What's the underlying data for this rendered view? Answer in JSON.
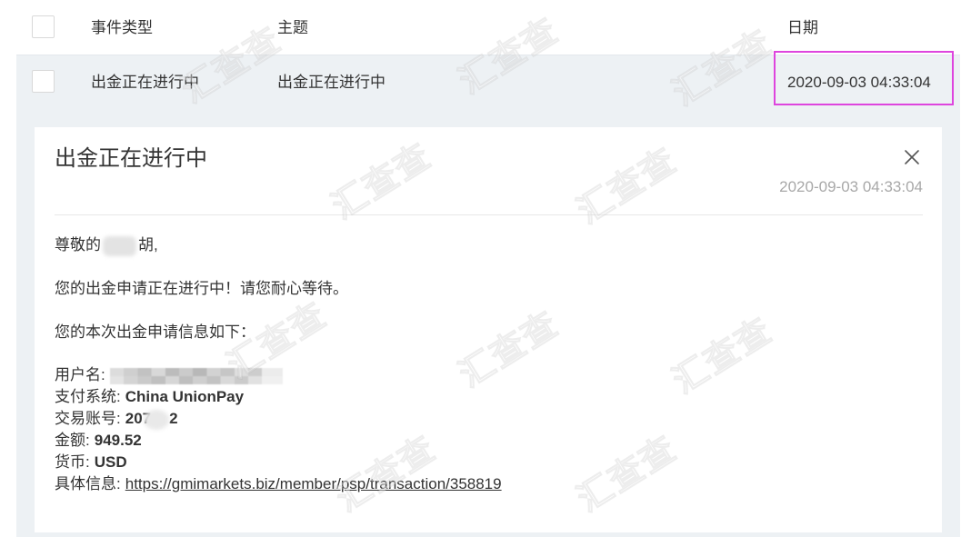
{
  "list": {
    "header": {
      "event_type": "事件类型",
      "subject": "主题",
      "date": "日期"
    },
    "rows": [
      {
        "event_type": "出金正在进行中",
        "subject": "出金正在进行中",
        "date": "2020-09-03 04:33:04"
      }
    ]
  },
  "message": {
    "title": "出金正在进行中",
    "date": "2020-09-03 04:33:04",
    "greeting_prefix": "尊敬的",
    "greeting_suffix": "胡,",
    "line_progress": "您的出金申请正在进行中！请您耐心等待。",
    "line_intro": "您的本次出金申请信息如下：",
    "details": {
      "username_label": "用户名:",
      "payment_system_label": "支付系统:",
      "payment_system": "China UnionPay",
      "account_label": "交易账号:",
      "account_prefix": "207",
      "account_suffix": "2",
      "amount_label": "金额:",
      "amount": "949.52",
      "currency_label": "货币:",
      "currency": "USD",
      "info_label": "具体信息:",
      "info_link": "https://gmimarkets.biz/member/psp/transaction/358819"
    }
  },
  "watermark": {
    "text": "汇查查"
  },
  "colors": {
    "panel_background": "#edf1f4",
    "highlight_border": "#de45de",
    "text": "#333333",
    "muted_text": "#a8a8a8"
  },
  "icons": {
    "close": "close-icon",
    "checkbox": "checkbox-unchecked-icon"
  }
}
